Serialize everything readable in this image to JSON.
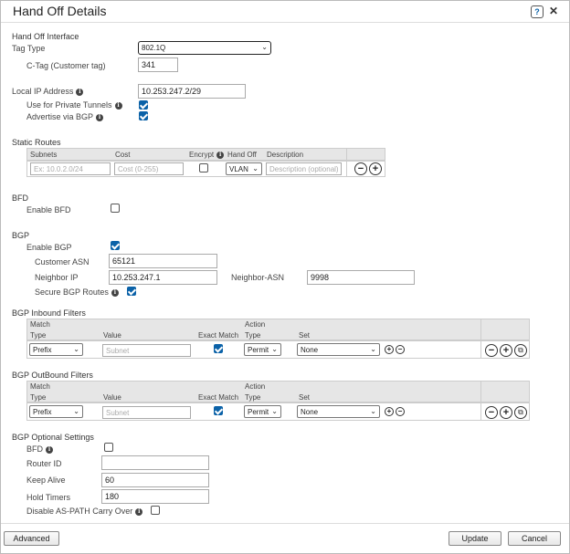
{
  "dialog": {
    "title": "Hand Off Details",
    "help_label": "?",
    "close_label": "✕"
  },
  "handoff": {
    "section": "Hand Off Interface",
    "tag_type_label": "Tag Type",
    "tag_type_value": "802.1Q",
    "ctag_label": "C-Tag (Customer tag)",
    "ctag_value": "341",
    "local_ip_label": "Local IP Address",
    "local_ip_value": "10.253.247.2/29",
    "private_tunnels_label": "Use for Private Tunnels",
    "advertise_bgp_label": "Advertise via BGP"
  },
  "static_routes": {
    "section": "Static Routes",
    "headers": [
      "Subnets",
      "Cost",
      "Encrypt",
      "Hand Off",
      "Description"
    ],
    "subnet_placeholder": "Ex: 10.0.2.0/24",
    "cost_placeholder": "Cost (0-255)",
    "handoff_value": "VLAN",
    "description_placeholder": "Description (optional)"
  },
  "bfd": {
    "section": "BFD",
    "enable_label": "Enable BFD"
  },
  "bgp": {
    "section": "BGP",
    "enable_label": "Enable BGP",
    "customer_asn_label": "Customer ASN",
    "customer_asn_value": "65121",
    "neighbor_ip_label": "Neighbor IP",
    "neighbor_ip_value": "10.253.247.1",
    "neighbor_asn_label": "Neighbor-ASN",
    "neighbor_asn_value": "9998",
    "secure_label": "Secure BGP Routes"
  },
  "inbound": {
    "section": "BGP Inbound Filters",
    "match_label": "Match",
    "action_label": "Action",
    "headers": [
      "Type",
      "Value",
      "Exact Match",
      "Type",
      "Set"
    ],
    "type_value": "Prefix",
    "value_placeholder": "Subnet",
    "action_type_value": "Permit",
    "set_value": "None"
  },
  "outbound": {
    "section": "BGP OutBound Filters",
    "match_label": "Match",
    "action_label": "Action",
    "headers": [
      "Type",
      "Value",
      "Exact Match",
      "Type",
      "Set"
    ],
    "type_value": "Prefix",
    "value_placeholder": "Subnet",
    "action_type_value": "Permit",
    "set_value": "None"
  },
  "optional": {
    "section": "BGP Optional Settings",
    "bfd_label": "BFD",
    "router_id_label": "Router ID",
    "router_id_value": "",
    "keep_alive_label": "Keep Alive",
    "keep_alive_value": "60",
    "hold_timers_label": "Hold Timers",
    "hold_timers_value": "180",
    "disable_as_path_label": "Disable AS-PATH Carry Over"
  },
  "footer": {
    "advanced_label": "Advanced",
    "update_label": "Update",
    "cancel_label": "Cancel"
  },
  "icons": {
    "info": "info-icon",
    "add": "plus-icon",
    "remove": "minus-icon",
    "copy": "copy-icon"
  },
  "colors": {
    "checkbox_checked": "#0b62a8",
    "table_header": "#e6e6e6"
  }
}
